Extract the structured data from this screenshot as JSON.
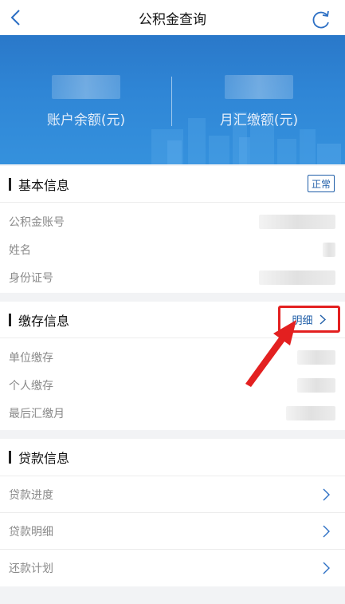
{
  "header": {
    "title": "公积金查询",
    "back_icon": "chevron-left-icon",
    "refresh_icon": "refresh-icon"
  },
  "banner": {
    "balance_label": "账户余额(元)",
    "monthly_label": "月汇缴额(元)"
  },
  "basic_info": {
    "title": "基本信息",
    "status": "正常",
    "rows": [
      {
        "label": "公积金账号"
      },
      {
        "label": "姓名"
      },
      {
        "label": "身份证号"
      }
    ]
  },
  "deposit_info": {
    "title": "缴存信息",
    "detail_label": "明细",
    "rows": [
      {
        "label": "单位缴存"
      },
      {
        "label": "个人缴存"
      },
      {
        "label": "最后汇缴月"
      }
    ]
  },
  "loan_info": {
    "title": "贷款信息",
    "rows": [
      {
        "label": "贷款进度"
      },
      {
        "label": "贷款明细"
      },
      {
        "label": "还款计划"
      }
    ]
  },
  "colors": {
    "accent_blue": "#1f5ea8",
    "banner_blue": "#2f86d6",
    "highlight_red": "#e32020",
    "navbar_icon": "#2c6fc4"
  }
}
